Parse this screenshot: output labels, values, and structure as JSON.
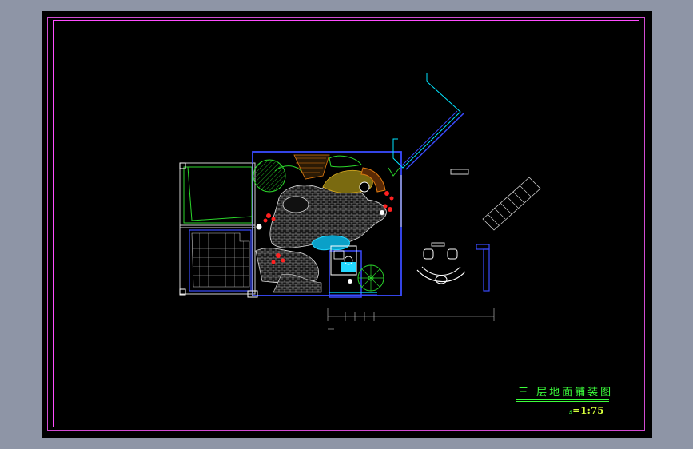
{
  "drawing": {
    "title": "三 层地面铺装图",
    "scale_prefix": "s",
    "scale_value": "=1:75"
  },
  "colors": {
    "background": "#000000",
    "frame": "#ff4dff",
    "title": "#3cff3c",
    "walls": "#3a4bff",
    "paving": "#bbbbbb",
    "lawn": "#2bd62b",
    "planting_red": "#ff2020",
    "deck_orange": "#e07a10",
    "water": "#22d8ff",
    "window_cyan": "#00e5ff"
  },
  "icons": {
    "spiral_stair": "spiral-stair-icon",
    "table_set": "table-chair-set-icon",
    "shrub": "shrub-icon"
  }
}
